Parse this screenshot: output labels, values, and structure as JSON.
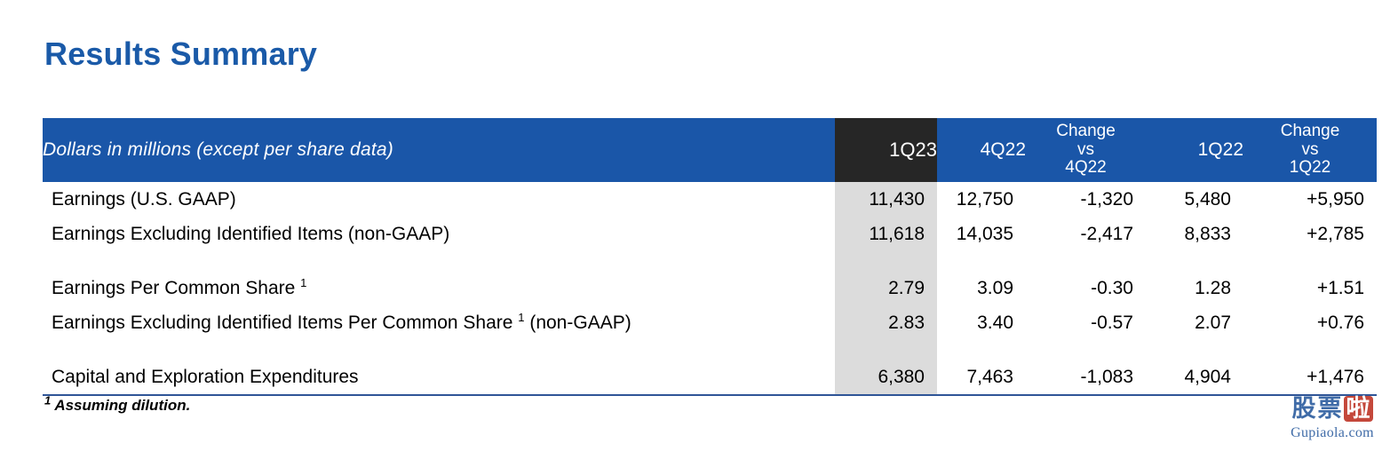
{
  "title": "Results Summary",
  "table": {
    "header": {
      "label": "Dollars in millions (except per share data)",
      "col_1q23": "1Q23",
      "col_4q22": "4Q22",
      "col_change_4q22_l1": "Change",
      "col_change_4q22_l2": "vs",
      "col_change_4q22_l3": "4Q22",
      "col_1q22": "1Q22",
      "col_change_1q22_l1": "Change",
      "col_change_1q22_l2": "vs",
      "col_change_1q22_l3": "1Q22"
    },
    "rows": [
      {
        "label": "Earnings (U.S. GAAP)",
        "footnote_marker": "",
        "label_suffix": "",
        "q1_23": "11,430",
        "q4_22": "12,750",
        "change_vs_4q22": "-1,320",
        "q1_22": "5,480",
        "change_vs_1q22": "+5,950"
      },
      {
        "label": "Earnings Excluding Identified Items (non-GAAP)",
        "footnote_marker": "",
        "label_suffix": "",
        "q1_23": "11,618",
        "q4_22": "14,035",
        "change_vs_4q22": "-2,417",
        "q1_22": "8,833",
        "change_vs_1q22": "+2,785"
      },
      {
        "label": "Earnings Per Common Share ",
        "footnote_marker": "1",
        "label_suffix": "",
        "q1_23": "2.79",
        "q4_22": "3.09",
        "change_vs_4q22": "-0.30",
        "q1_22": "1.28",
        "change_vs_1q22": "+1.51"
      },
      {
        "label": "Earnings Excluding Identified Items Per Common Share ",
        "footnote_marker": "1",
        "label_suffix": " (non-GAAP)",
        "q1_23": "2.83",
        "q4_22": "3.40",
        "change_vs_4q22": "-0.57",
        "q1_22": "2.07",
        "change_vs_1q22": "+0.76"
      },
      {
        "label": "Capital and Exploration Expenditures",
        "footnote_marker": "",
        "label_suffix": "",
        "q1_23": "6,380",
        "q4_22": "7,463",
        "change_vs_4q22": "-1,083",
        "q1_22": "4,904",
        "change_vs_1q22": "+1,476"
      }
    ]
  },
  "footnote": {
    "marker": "1",
    "text": " Assuming dilution."
  },
  "watermark": {
    "glyph1": "股",
    "glyph2": "票",
    "glyph3": "啦",
    "text": "Gupiaola.com"
  },
  "colors": {
    "header_blue": "#1a56a8",
    "title_blue": "#1a5aa8",
    "highlight_dark": "#262626",
    "highlight_grey": "#dcdcdc",
    "rule_blue": "#2f5597",
    "watermark_blue": "#2f5fa0",
    "watermark_red": "#c0392b"
  }
}
